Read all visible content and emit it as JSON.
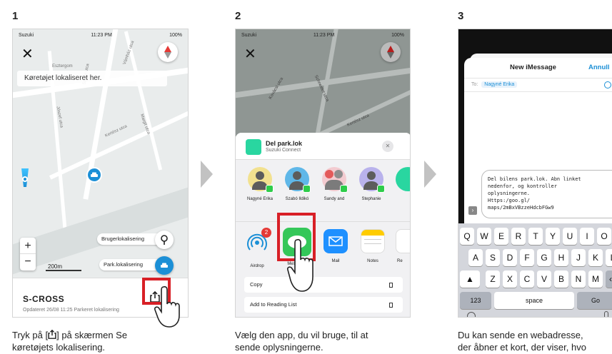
{
  "steps": [
    {
      "num": "1",
      "caption_line1": "Tryk på [",
      "caption_line1b": "] på skærmen Se",
      "caption_line2": "køretøjets lokalisering."
    },
    {
      "num": "2",
      "caption_line1": "Vælg den app, du vil bruge, til at",
      "caption_line2": "sende oplysningerne."
    },
    {
      "num": "3",
      "caption_line1": "Du kan sende en webadresse,",
      "caption_line2": "der åbner et kort, der viser, hvo"
    }
  ],
  "screen1": {
    "carrier": "Suzuki",
    "time": "11:23 PM",
    "battery": "100%",
    "banner": "Køretøjet lokaliseret her.",
    "streets": [
      "Esztergom",
      "Kertész utca",
      "Margit utca",
      "Vámház utca",
      "Fürdő utca",
      "Jószef utca",
      "Sziget utca"
    ],
    "scale": "200m",
    "user_location_label": "Brugerlokalisering",
    "park_location_label": "Park.lokalisering",
    "vehicle_name": "S-CROSS",
    "updated": "Opdateret 26/08 11:25 Parkeret lokalisering",
    "colors": {
      "accent": "#1b8fd6",
      "highlight": "#d81f26"
    }
  },
  "screen2": {
    "carrier": "Suzuki",
    "time": "11:23 PM",
    "battery": "100%",
    "streets": [
      "Kovácsi utca",
      "Schneider utca",
      "Kertész utca"
    ],
    "share_title": "Del park.lok",
    "share_subtitle": "Suzuki Connect",
    "contacts": [
      "Nagyné Erika",
      "Szabó Ildikó",
      "Sandy and",
      "Stephanie"
    ],
    "apps": [
      "Airdrop",
      "Messages",
      "Mail",
      "Notes",
      "Re"
    ],
    "airdrop_badge": "2",
    "actions": [
      "Copy",
      "Add to Reading List"
    ]
  },
  "screen3": {
    "title": "New iMessage",
    "cancel": "Annull",
    "to_label": "To:",
    "recipient": "Nagyné Erika",
    "message_lines": [
      "Del bilens park.lok. Abn linket",
      "nedenfor, og kontroller",
      "oplysningerne.",
      "Https:/goo.gl/",
      "maps/2mBxVBzzeHdcbFGw9"
    ],
    "keyboard_row1": [
      "Q",
      "W",
      "E",
      "R",
      "T",
      "Y",
      "U",
      "I",
      "O"
    ],
    "keyboard_row2": [
      "A",
      "S",
      "D",
      "F",
      "G",
      "H",
      "J",
      "K",
      "L"
    ],
    "keyboard_row3": [
      "Z",
      "X",
      "C",
      "V",
      "B",
      "N",
      "M"
    ],
    "key_numbers": "123",
    "key_space": "space",
    "key_go": "Go"
  }
}
